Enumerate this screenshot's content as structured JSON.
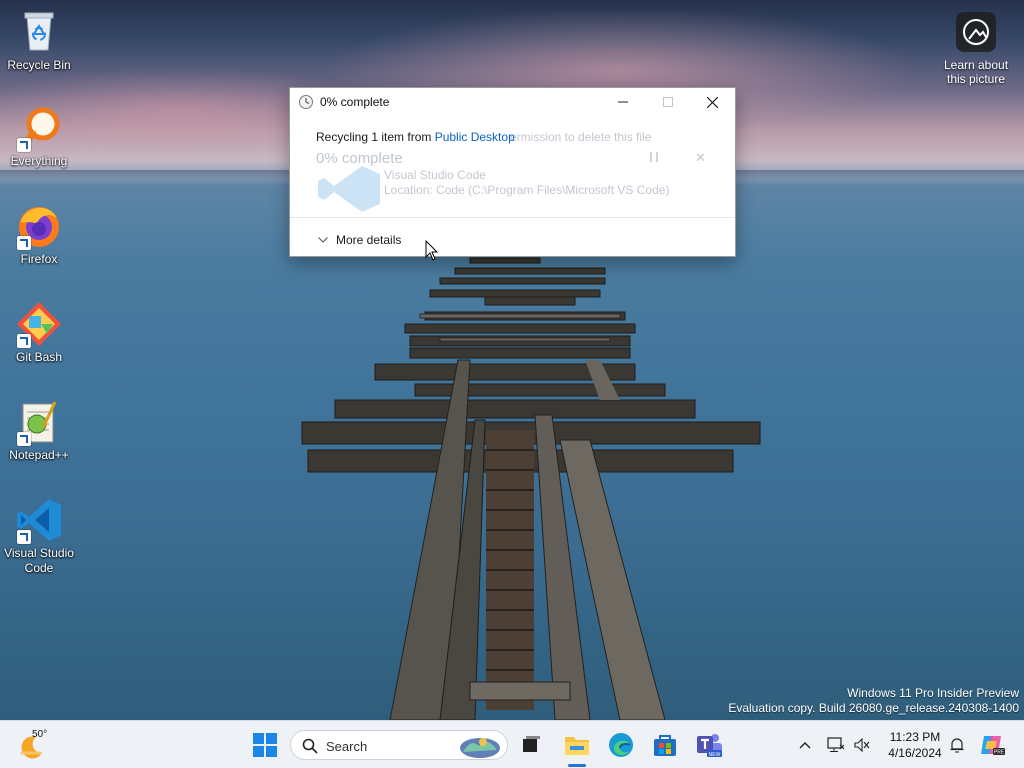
{
  "desktop": {
    "icons": [
      {
        "label": "Recycle Bin",
        "icon": "recycle-bin-icon"
      },
      {
        "label": "Everything",
        "icon": "everything-search-icon"
      },
      {
        "label": "Firefox",
        "icon": "firefox-icon"
      },
      {
        "label": "Git Bash",
        "icon": "git-bash-icon"
      },
      {
        "label": "Notepad++",
        "icon": "notepadpp-icon"
      },
      {
        "label": "Visual Studio Code",
        "icon": "vscode-icon"
      }
    ],
    "learn_about": "Learn about this picture",
    "watermark": {
      "line1": "Windows 11 Pro Insider Preview",
      "line2": "Evaluation copy. Build 26080.ge_release.240308-1400"
    }
  },
  "dialog": {
    "title": "0% complete",
    "recycling_prefix": "Recycling 1 item from ",
    "recycling_location": "Public Desktop",
    "ghost_permission": "ermission to delete this file",
    "ghost_percent": "0% complete",
    "ghost_item_name": "Visual Studio Code",
    "ghost_item_location": "Location: Code (C:\\Program Files\\Microsoft VS Code)",
    "more_details": "More details",
    "progress_percent": 0
  },
  "taskbar": {
    "weather_temp": "50°",
    "search_label": "Search",
    "time": "11:23 PM",
    "date": "4/16/2024",
    "accent": "#2473d6"
  }
}
